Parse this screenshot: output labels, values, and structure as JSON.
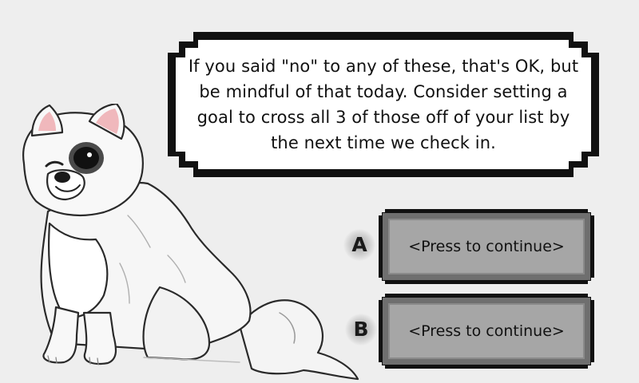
{
  "dialog": {
    "message": "If you said \"no\" to any of these, that's OK, but be mindful of that today. Consider setting a goal to cross all 3 of those off of your list by the next time we check in."
  },
  "choices": [
    {
      "key": "A",
      "label": "<Press to continue>"
    },
    {
      "key": "B",
      "label": "<Press to continue>"
    }
  ],
  "colors": {
    "background": "#eeeeee",
    "panel_border": "#111111",
    "panel_fill": "#ffffff",
    "button_face": "#a6a6a6",
    "button_bevel": "#6f6f6f"
  },
  "character": {
    "icon": "white-dog-with-eye-patch"
  }
}
